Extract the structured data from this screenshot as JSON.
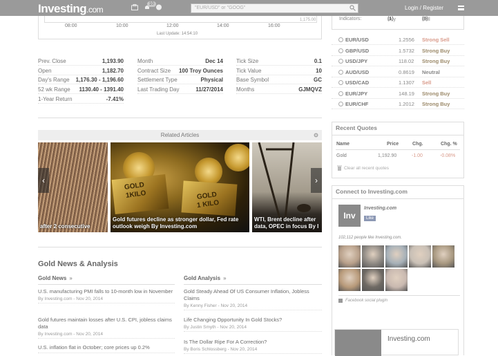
{
  "header": {
    "logo_main": "Investing",
    "logo_suffix": ".com",
    "notif_count": "10",
    "search_placeholder": "\"EUR/USD\" or \"GOOG\"",
    "login_label": "Login / Register"
  },
  "chart": {
    "times": [
      "08:00",
      "10:00",
      "12:00",
      "14:00",
      "16:00"
    ],
    "price_label": "1,175.00",
    "last_update": "Last Update: 14:54:10"
  },
  "stats": {
    "col1": [
      {
        "k": "Prev. Close",
        "v": "1,193.90"
      },
      {
        "k": "Open",
        "v": "1,182.70"
      },
      {
        "k": "Day's Range",
        "v": "1,176.30 - 1,196.60"
      },
      {
        "k": "52 wk Range",
        "v": "1130.40 - 1391.40"
      },
      {
        "k": "1-Year Return",
        "v": "-7.41%"
      }
    ],
    "col2": [
      {
        "k": "Month",
        "v": "Dec 14"
      },
      {
        "k": "Contract Size",
        "v": "100 Troy Ounces"
      },
      {
        "k": "Settlement Type",
        "v": "Physical"
      },
      {
        "k": "Last Trading Day",
        "v": "11/27/2014"
      }
    ],
    "col3": [
      {
        "k": "Tick Size",
        "v": "0.1"
      },
      {
        "k": "Tick Value",
        "v": "10"
      },
      {
        "k": "Base Symbol",
        "v": "GC"
      },
      {
        "k": "Months",
        "v": "GJMQVZ"
      }
    ]
  },
  "related": {
    "title": "Related Articles",
    "slides": [
      {
        "caption": "after 2 consecutive"
      },
      {
        "caption": "Gold futures decline as stronger dollar, Fed rate outlook weigh By Investing.com",
        "gold1": "GOLD",
        "kilo1": "1KILO",
        "gold2": "GOLD",
        "kilo2": "1 KILO"
      },
      {
        "caption": "WTI, Brent decline after data, OPEC in focus By I"
      }
    ]
  },
  "news": {
    "section_title": "Gold News & Analysis",
    "news_title": "Gold News",
    "analysis_title": "Gold Analysis",
    "raquo": "»",
    "news_items": [
      {
        "t": "U.S. manufacturing PMI falls to 10-month low in November",
        "m": "By Investing.com - Nov 20, 2014"
      },
      {
        "t": "Gold futures maintain losses after U.S. CPI, jobless claims data",
        "m": "By Investing.com - Nov 20, 2014"
      },
      {
        "t": "U.S. inflation flat in October; core prices up 0.2%",
        "m": ""
      }
    ],
    "analysis_items": [
      {
        "t": "Gold Steady Ahead Of US Consumer Inflation, Jobless Claims",
        "m": "By Kenny Fisher - Nov 20, 2014"
      },
      {
        "t": "Life Changing Opportunity In Gold Stocks?",
        "m": "By Justin Smyth - Nov 20, 2014"
      },
      {
        "t": "Is The Dollar Ripe For A Correction?",
        "m": "By Boris Schlossberg - Nov 20, 2014"
      }
    ]
  },
  "indicators": {
    "label": "Indicators:",
    "buy": "Buy",
    "buy_n": "(1)",
    "sell": "Sell",
    "sell_n": "(8)"
  },
  "pairs": [
    {
      "n": "EUR/USD",
      "p": "1.2556",
      "s": "Strong Sell",
      "c": "#d99a8a"
    },
    {
      "n": "GBP/USD",
      "p": "1.5732",
      "s": "Strong Buy",
      "c": "#9c8a6a"
    },
    {
      "n": "USD/JPY",
      "p": "118.02",
      "s": "Strong Buy",
      "c": "#9c8a6a"
    },
    {
      "n": "AUD/USD",
      "p": "0.8619",
      "s": "Neutral",
      "c": "#888888"
    },
    {
      "n": "USD/CAD",
      "p": "1.1307",
      "s": "Sell",
      "c": "#d99a8a"
    },
    {
      "n": "EUR/JPY",
      "p": "148.19",
      "s": "Strong Buy",
      "c": "#9c8a6a"
    },
    {
      "n": "EUR/CHF",
      "p": "1.2012",
      "s": "Strong Buy",
      "c": "#9c8a6a"
    }
  ],
  "recent_quotes": {
    "title": "Recent Quotes",
    "headers": [
      "Name",
      "Price",
      "Chg.",
      "Chg. %"
    ],
    "row": [
      "Gold",
      "1,192.90",
      "-1.00",
      "-0.08%"
    ],
    "clear": "Clear all recent quotes"
  },
  "connect": {
    "title": "Connect to Investing.com",
    "card_name": "Investing.com",
    "inv_logo": "Inv",
    "like": "Like",
    "people": "102,112 people like Investing.com.",
    "plugin": "Facebook social plugin",
    "bottom_name": "Investing.com"
  }
}
